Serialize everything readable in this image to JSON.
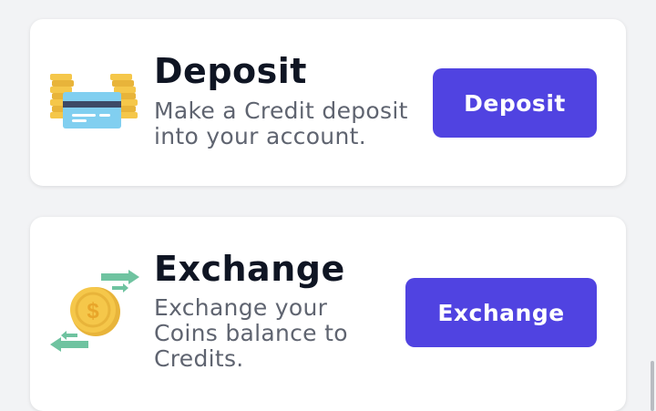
{
  "deposit": {
    "title": "Deposit",
    "description": "Make a Credit deposit into your account.",
    "button_label": "Deposit",
    "icon": "coins-credit-card-icon"
  },
  "exchange": {
    "title": "Exchange",
    "description": "Exchange your Coins balance to Credits.",
    "button_label": "Exchange",
    "icon": "coin-exchange-arrows-icon"
  },
  "colors": {
    "accent": "#5043e1",
    "coin": "#f5c74a",
    "card": "#81cff0",
    "arrow": "#6fc3a0",
    "title": "#0f1523",
    "muted": "#5f6470"
  }
}
